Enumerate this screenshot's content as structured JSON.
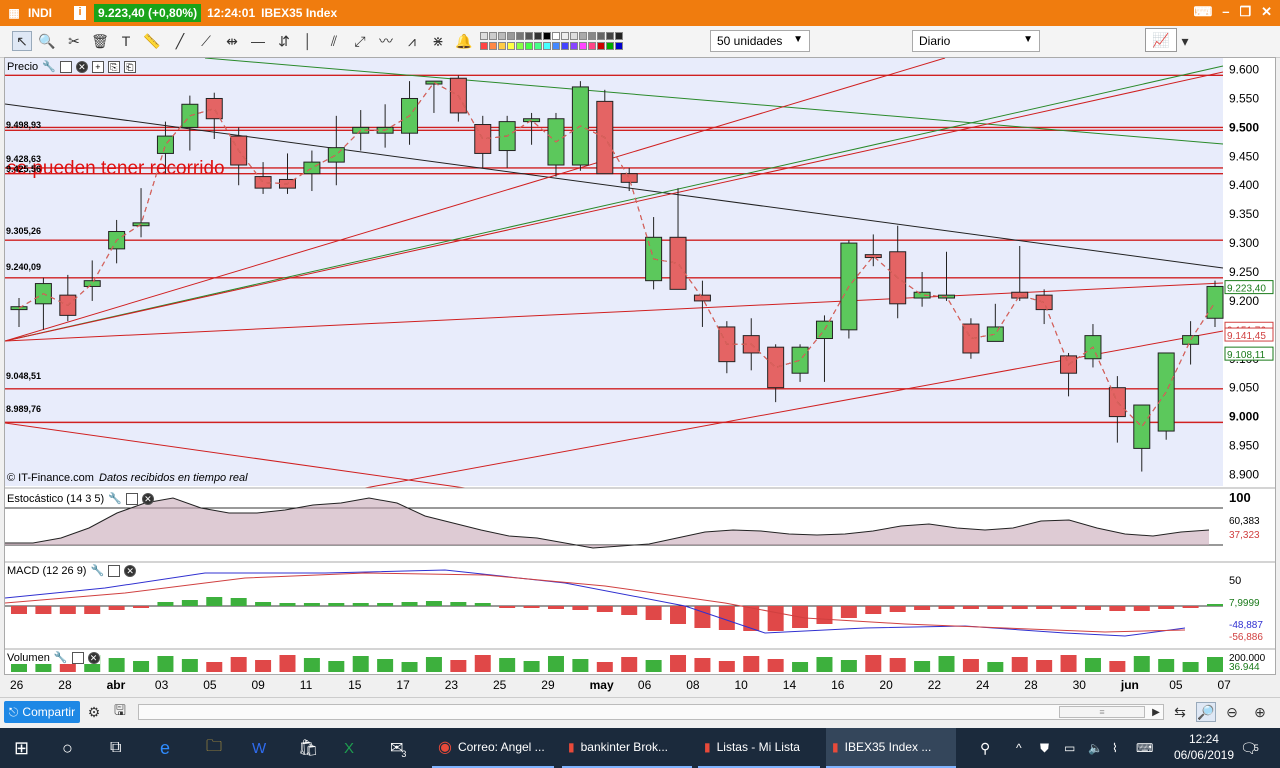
{
  "window": {
    "app_label": "INDI",
    "price_badge": "9.223,40 (+0,80%)",
    "time": "12:24:01",
    "title": "IBEX35 Index"
  },
  "toolbar": {
    "units_select": "50 unidades",
    "period_select": "Diario"
  },
  "panels": {
    "price": "Precio",
    "stochastic": "Estocástico (14 3 5)",
    "macd": "MACD (12 26 9)",
    "volume": "Volumen"
  },
  "chart": {
    "annotation": "se pueden tener recorrido",
    "credit_source": "© IT-Finance.com",
    "credit_text": "Datos recibidos en tiempo real",
    "price_axis": [
      "9.600",
      "9.550",
      "9.500",
      "9.450",
      "9.400",
      "9.350",
      "9.300",
      "9.250",
      "9.200",
      "9.150",
      "9.100",
      "9.050",
      "9.000",
      "8.950",
      "8.900"
    ],
    "level_labels": [
      "9.498,93",
      "9.428,63",
      "9.425,56",
      "9.305,26",
      "9.240,09",
      "9.048,51",
      "8.989,76"
    ],
    "right_tags": {
      "current": "9.223,40",
      "ma1": "9.151,76",
      "ma2": "9.141,45",
      "ma3": "9.108,11"
    },
    "stoch_axis_top": "100",
    "stoch_vals": [
      "60,383",
      "37,323"
    ],
    "macd_axis_top": "50",
    "macd_vals": [
      "7,9999",
      "-48,887",
      "-56,886"
    ],
    "vol_axis_top": "200.000",
    "vol_val": "36.944",
    "date_axis": [
      "26",
      "28",
      "abr",
      "03",
      "05",
      "09",
      "11",
      "15",
      "17",
      "23",
      "25",
      "29",
      "may",
      "06",
      "08",
      "10",
      "14",
      "16",
      "20",
      "22",
      "24",
      "28",
      "30",
      "jun",
      "05",
      "07"
    ]
  },
  "chart_data": {
    "type": "candlestick",
    "title": "IBEX35 Index",
    "ylim": [
      8880,
      9620
    ],
    "candles": [
      {
        "o": 9185,
        "h": 9205,
        "l": 9155,
        "c": 9190
      },
      {
        "o": 9195,
        "h": 9240,
        "l": 9150,
        "c": 9230
      },
      {
        "o": 9210,
        "h": 9245,
        "l": 9165,
        "c": 9175
      },
      {
        "o": 9225,
        "h": 9270,
        "l": 9200,
        "c": 9235
      },
      {
        "o": 9290,
        "h": 9340,
        "l": 9265,
        "c": 9320
      },
      {
        "o": 9330,
        "h": 9395,
        "l": 9310,
        "c": 9335
      },
      {
        "o": 9455,
        "h": 9510,
        "l": 9420,
        "c": 9485
      },
      {
        "o": 9500,
        "h": 9555,
        "l": 9460,
        "c": 9540
      },
      {
        "o": 9550,
        "h": 9560,
        "l": 9480,
        "c": 9515
      },
      {
        "o": 9485,
        "h": 9500,
        "l": 9400,
        "c": 9435
      },
      {
        "o": 9415,
        "h": 9440,
        "l": 9385,
        "c": 9395
      },
      {
        "o": 9410,
        "h": 9455,
        "l": 9385,
        "c": 9395
      },
      {
        "o": 9420,
        "h": 9460,
        "l": 9390,
        "c": 9440
      },
      {
        "o": 9440,
        "h": 9520,
        "l": 9400,
        "c": 9465
      },
      {
        "o": 9490,
        "h": 9530,
        "l": 9460,
        "c": 9500
      },
      {
        "o": 9490,
        "h": 9540,
        "l": 9465,
        "c": 9500
      },
      {
        "o": 9490,
        "h": 9580,
        "l": 9470,
        "c": 9550
      },
      {
        "o": 9575,
        "h": 9580,
        "l": 9525,
        "c": 9580
      },
      {
        "o": 9585,
        "h": 9590,
        "l": 9510,
        "c": 9525
      },
      {
        "o": 9505,
        "h": 9520,
        "l": 9430,
        "c": 9455
      },
      {
        "o": 9460,
        "h": 9520,
        "l": 9430,
        "c": 9510
      },
      {
        "o": 9510,
        "h": 9525,
        "l": 9470,
        "c": 9515
      },
      {
        "o": 9435,
        "h": 9525,
        "l": 9415,
        "c": 9515
      },
      {
        "o": 9435,
        "h": 9580,
        "l": 9425,
        "c": 9570
      },
      {
        "o": 9545,
        "h": 9565,
        "l": 9425,
        "c": 9420
      },
      {
        "o": 9420,
        "h": 9430,
        "l": 9390,
        "c": 9405
      },
      {
        "o": 9235,
        "h": 9345,
        "l": 9220,
        "c": 9310
      },
      {
        "o": 9310,
        "h": 9395,
        "l": 9220,
        "c": 9220
      },
      {
        "o": 9210,
        "h": 9235,
        "l": 9155,
        "c": 9200
      },
      {
        "o": 9155,
        "h": 9165,
        "l": 9075,
        "c": 9095
      },
      {
        "o": 9140,
        "h": 9170,
        "l": 9080,
        "c": 9110
      },
      {
        "o": 9120,
        "h": 9125,
        "l": 9025,
        "c": 9050
      },
      {
        "o": 9075,
        "h": 9125,
        "l": 9060,
        "c": 9120
      },
      {
        "o": 9135,
        "h": 9175,
        "l": 9060,
        "c": 9165
      },
      {
        "o": 9150,
        "h": 9305,
        "l": 9135,
        "c": 9300
      },
      {
        "o": 9280,
        "h": 9315,
        "l": 9260,
        "c": 9275
      },
      {
        "o": 9285,
        "h": 9330,
        "l": 9170,
        "c": 9195
      },
      {
        "o": 9205,
        "h": 9250,
        "l": 9190,
        "c": 9215
      },
      {
        "o": 9205,
        "h": 9285,
        "l": 9200,
        "c": 9210
      },
      {
        "o": 9160,
        "h": 9170,
        "l": 9100,
        "c": 9110
      },
      {
        "o": 9130,
        "h": 9195,
        "l": 9130,
        "c": 9155
      },
      {
        "o": 9215,
        "h": 9295,
        "l": 9200,
        "c": 9205
      },
      {
        "o": 9210,
        "h": 9220,
        "l": 9160,
        "c": 9185
      },
      {
        "o": 9105,
        "h": 9110,
        "l": 9035,
        "c": 9075
      },
      {
        "o": 9100,
        "h": 9160,
        "l": 9085,
        "c": 9140
      },
      {
        "o": 9050,
        "h": 9070,
        "l": 8955,
        "c": 9000
      },
      {
        "o": 8945,
        "h": 9015,
        "l": 8905,
        "c": 9020
      },
      {
        "o": 8975,
        "h": 9110,
        "l": 8960,
        "c": 9110
      },
      {
        "o": 9125,
        "h": 9165,
        "l": 9090,
        "c": 9140
      },
      {
        "o": 9170,
        "h": 9235,
        "l": 9155,
        "c": 9225
      }
    ],
    "horizontal_levels": [
      9590,
      9500,
      9495,
      9430,
      9420,
      9305,
      9240,
      9048,
      8990
    ],
    "stochastic": {
      "k": 60.383,
      "d": 37.323
    },
    "macd": {
      "hist": 7.9999,
      "macd": -48.887,
      "signal": -56.886
    },
    "volume_last": 36944,
    "grid": true
  },
  "statusbar": {
    "share_label": "Compartir"
  },
  "taskbar": {
    "items": [
      {
        "label": "Correo: Angel ..."
      },
      {
        "label": "bankinter Brok..."
      },
      {
        "label": "Listas - Mi Lista"
      },
      {
        "label": "IBEX35 Index ..."
      }
    ],
    "mail_badge": "3",
    "time": "12:24",
    "date": "06/06/2019",
    "notif_count": "5"
  },
  "colors": {
    "titlebar": "#f07c0e",
    "up_candle": "#5cc85c",
    "down_candle": "#e46464",
    "chart_bg": "#e8ecfb",
    "taskbar": "#1b2a3c"
  }
}
